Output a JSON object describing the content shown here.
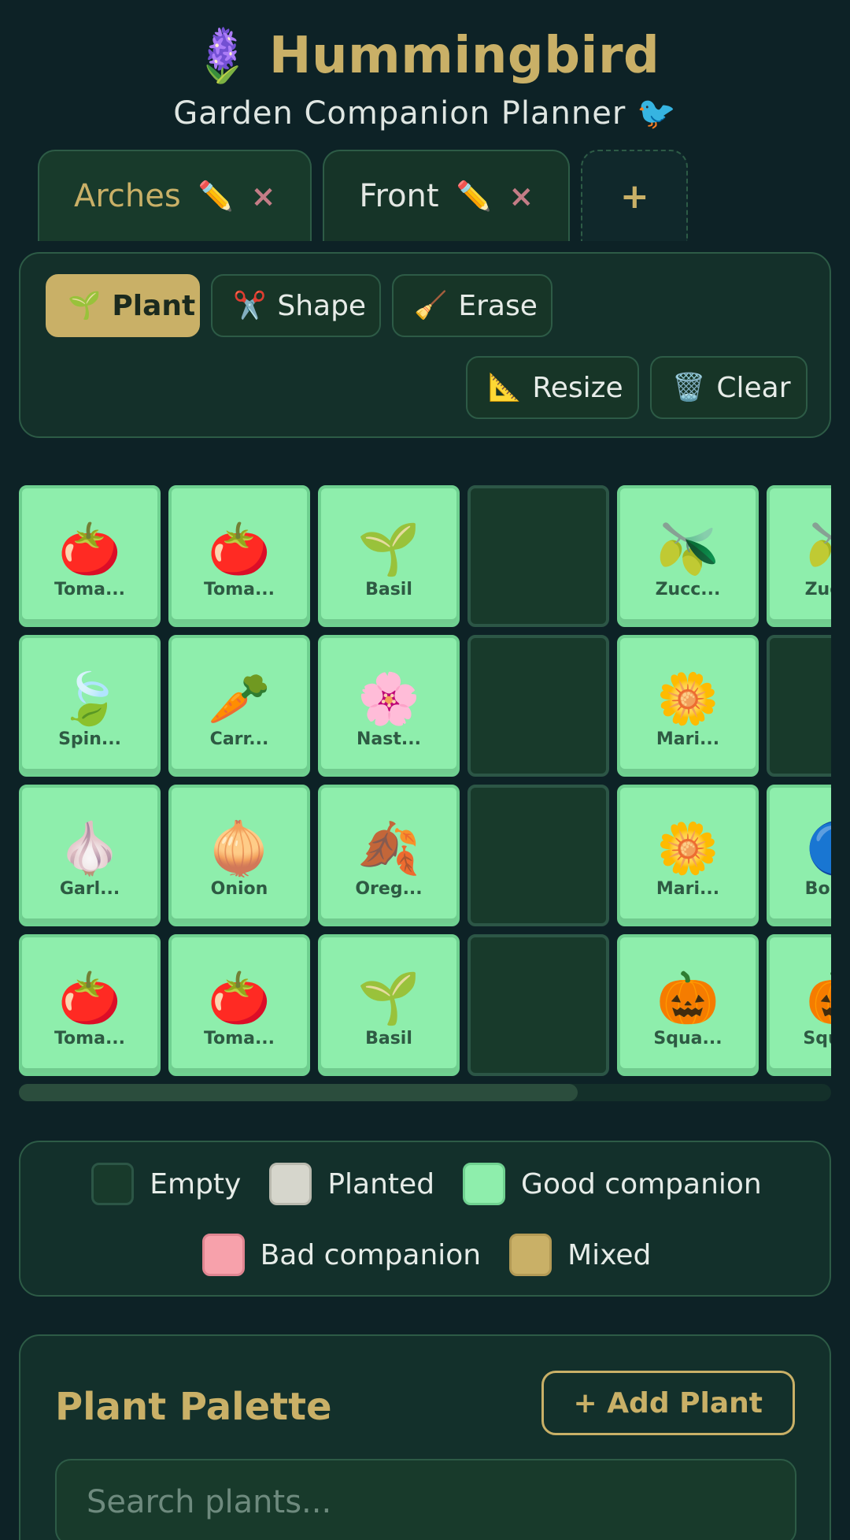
{
  "header": {
    "icon": "🪻",
    "title": "Hummingbird",
    "subtitle": "Garden Companion Planner 🐦"
  },
  "tabs": [
    {
      "label": "Arches",
      "active": true,
      "edit_icon": "✏️",
      "close_icon": "×"
    },
    {
      "label": "Front",
      "active": false,
      "edit_icon": "✏️",
      "close_icon": "×"
    }
  ],
  "tab_add_label": "+",
  "toolbar": {
    "plant": {
      "icon": "🌱",
      "label": "Plant"
    },
    "shape": {
      "icon": "✂️",
      "label": "Shape"
    },
    "erase": {
      "icon": "🧹",
      "label": "Erase"
    },
    "resize": {
      "icon": "📐",
      "label": "Resize"
    },
    "clear": {
      "icon": "🗑️",
      "label": "Clear"
    }
  },
  "grid": {
    "rows": [
      [
        {
          "icon": "🍅",
          "label": "Toma..."
        },
        {
          "icon": "🍅",
          "label": "Toma..."
        },
        {
          "icon": "🌱",
          "label": "Basil"
        },
        null,
        {
          "icon": "🫒",
          "label": "Zucc..."
        },
        {
          "icon": "🫒",
          "label": "Zucc..."
        }
      ],
      [
        {
          "icon": "🍃",
          "label": "Spin..."
        },
        {
          "icon": "🥕",
          "label": "Carr..."
        },
        {
          "icon": "🌸",
          "label": "Nast..."
        },
        null,
        {
          "icon": "🌼",
          "label": "Mari..."
        },
        null
      ],
      [
        {
          "icon": "🧄",
          "label": "Garl..."
        },
        {
          "icon": "🧅",
          "label": "Onion"
        },
        {
          "icon": "🍂",
          "label": "Oreg..."
        },
        null,
        {
          "icon": "🌼",
          "label": "Mari..."
        },
        {
          "icon": "🔵",
          "label": "Bora..."
        }
      ],
      [
        {
          "icon": "🍅",
          "label": "Toma..."
        },
        {
          "icon": "🍅",
          "label": "Toma..."
        },
        {
          "icon": "🌱",
          "label": "Basil"
        },
        null,
        {
          "icon": "🎃",
          "label": "Squa..."
        },
        {
          "icon": "🎃",
          "label": "Squa..."
        }
      ]
    ]
  },
  "legend": {
    "row1": [
      {
        "label": "Empty",
        "fill": "#183a2b",
        "border": "#2c5646"
      },
      {
        "label": "Planted",
        "fill": "#d6d6cc",
        "border": "#b9b9ae"
      },
      {
        "label": "Good companion",
        "fill": "#8eeeac",
        "border": "#6fd190"
      }
    ],
    "row2": [
      {
        "label": "Bad companion",
        "fill": "#f7a1ab",
        "border": "#e08591"
      },
      {
        "label": "Mixed",
        "fill": "#c9b067",
        "border": "#b39a55"
      }
    ]
  },
  "palette": {
    "title": "Plant Palette",
    "add_label": "+ Add Plant",
    "search_placeholder": "Search plants..."
  },
  "colors": {
    "accent": "#c9b067",
    "background": "#0d2226",
    "good_companion": "#8eeeac"
  }
}
